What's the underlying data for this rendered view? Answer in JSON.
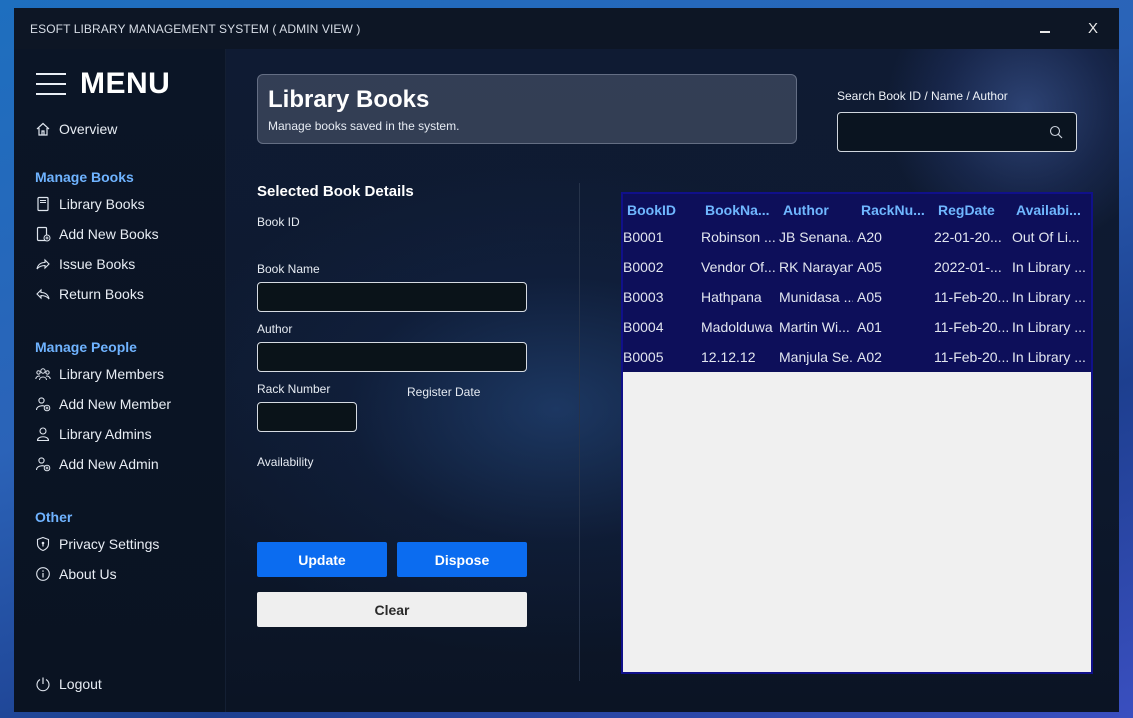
{
  "window": {
    "title": "ESOFT LIBRARY MANAGEMENT SYSTEM ( ADMIN VIEW )",
    "close_label": "X"
  },
  "sidebar": {
    "menu_label": "MENU",
    "overview": "Overview",
    "sections": {
      "books": "Manage Books",
      "people": "Manage People",
      "other": "Other"
    },
    "items": {
      "library_books": "Library Books",
      "add_new_books": "Add New Books",
      "issue_books": "Issue Books",
      "return_books": "Return Books",
      "library_members": "Library Members",
      "add_new_member": "Add New Member",
      "library_admins": "Library Admins",
      "add_new_admin": "Add New Admin",
      "privacy_settings": "Privacy Settings",
      "about_us": "About Us"
    },
    "logout": "Logout"
  },
  "header": {
    "title": "Library Books",
    "subtitle": "Manage books saved in the system."
  },
  "search": {
    "label": "Search Book ID / Name / Author",
    "value": ""
  },
  "details": {
    "title": "Selected Book Details",
    "book_id_label": "Book ID",
    "book_name_label": "Book Name",
    "book_name_value": "",
    "author_label": "Author",
    "author_value": "",
    "rack_label": "Rack Number",
    "rack_value": "",
    "register_date_label": "Register Date",
    "availability_label": "Availability"
  },
  "buttons": {
    "update": "Update",
    "dispose": "Dispose",
    "clear": "Clear"
  },
  "colors": {
    "accent": "#0b6cf0",
    "section": "#6fb3ff",
    "grid_header": "#0d0f5a"
  },
  "table": {
    "columns": [
      "BookID",
      "BookNa...",
      "Author",
      "RackNu...",
      "RegDate",
      "Availabi..."
    ],
    "rows": [
      [
        "B0001",
        "Robinson ...",
        "JB Senana...",
        "A20",
        "22-01-20...",
        "Out Of Li..."
      ],
      [
        "B0002",
        "Vendor Of...",
        "RK Narayan",
        "A05",
        "2022-01-...",
        "In Library ..."
      ],
      [
        "B0003",
        "Hathpana",
        "Munidasa ...",
        "A05",
        "11-Feb-20...",
        "In Library ..."
      ],
      [
        "B0004",
        "Madolduwa",
        "Martin Wi...",
        "A01",
        "11-Feb-20...",
        "In Library ..."
      ],
      [
        "B0005",
        "12.12.12",
        "Manjula Se...",
        "A02",
        "11-Feb-20...",
        "In Library ..."
      ]
    ]
  }
}
